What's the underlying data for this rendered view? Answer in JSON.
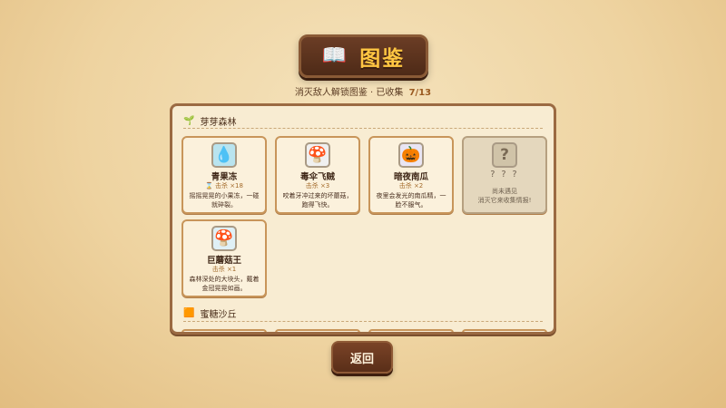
{
  "header": {
    "book_icon": "📖",
    "title": "图鉴",
    "subtitle": "消灭敌人解锁图鉴 · 已收集",
    "collected": "7/13"
  },
  "sections": [
    {
      "name": "芽芽森林",
      "icon": "🌱",
      "cards": [
        {
          "name": "青果冻",
          "kills": "击杀 ×18",
          "kill_icon": "⌛",
          "desc": "摇摇晃晃的小果冻，一碰就碎裂。",
          "portrait": "💧",
          "portrait_bg": "#b9e4ef"
        },
        {
          "name": "毒伞飞贼",
          "kills": "击杀 ×3",
          "desc": "咬着牙冲过来的坏蘑菇，跑得飞快。",
          "portrait": "🍄",
          "portrait_bg": "#f0f0f0"
        },
        {
          "name": "暗夜南瓜",
          "kills": "击杀 ×2",
          "desc": "夜里会发光的南瓜精，一脸不服气。",
          "portrait": "🎃",
          "portrait_bg": "#e9e5f3"
        },
        {
          "name": "? ? ?",
          "locked": true,
          "desc": "尚未遇见\n消灭它来收集情报!",
          "portrait": "?",
          "portrait_bg": "#d0c3a8"
        },
        {
          "name": "巨蘑菇王",
          "kills": "击杀 ×1",
          "desc": "森林深处的大块头，戴着金冠晃晃如画。",
          "portrait": "🍄",
          "portrait_bg": "#dff0f6"
        }
      ]
    },
    {
      "name": "蜜糖沙丘",
      "icon": "🟧"
    }
  ],
  "buttons": {
    "back": "返回"
  }
}
